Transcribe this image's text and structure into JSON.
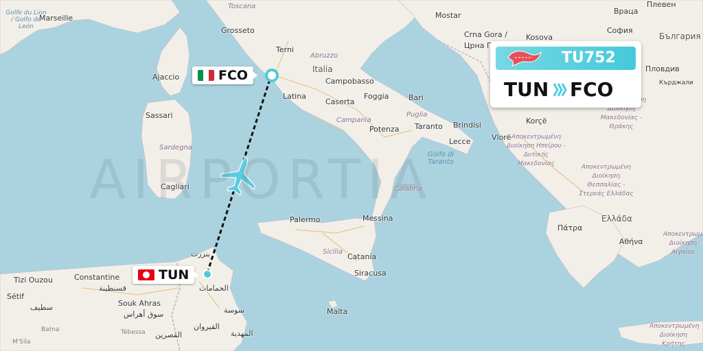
{
  "watermark": "AIRPORTIA",
  "flight": {
    "number": "TU752",
    "origin": "TUN",
    "destination": "FCO",
    "origin_flag": "tunisia-flag",
    "destination_flag": "italy-flag",
    "airline_logo": "tunisair-logo",
    "route_icon": "triple-chevron-right-icon",
    "aircraft_icon": "airplane-icon"
  },
  "colors": {
    "sea": "#aad3df",
    "land": "#f2efe9",
    "accent": "#4ecbdb",
    "route_line": "#111111"
  },
  "labels": {
    "marseille": "Marseille",
    "golfe": "Golfe du Lion / Golfo de León",
    "toscana": "Toscana",
    "grosseto": "Grosseto",
    "terni": "Terni",
    "abruzzo": "Abruzzo",
    "italia": "Italia",
    "campobasso": "Campobasso",
    "latina": "Latina",
    "caserta": "Caserta",
    "foggia": "Foggia",
    "bari": "Bari",
    "puglia": "Puglia",
    "campania": "Campania",
    "potenza": "Potenza",
    "taranto": "Taranto",
    "brindisi": "Brindisi",
    "lecce": "Lecce",
    "golfo_taranto": "Golfo di Taranto",
    "calabria": "Calabria",
    "ajaccio": "Ajaccio",
    "sassari": "Sassari",
    "sardegna": "Sardegna",
    "cagliari": "Cagliari",
    "palermo": "Palermo",
    "messina": "Messina",
    "sicilia": "Sicilia",
    "catania": "Catania",
    "siracusa": "Siracusa",
    "malta": "Malta",
    "mostar": "Mostar",
    "crna_gora": "Crna Gora /",
    "crna_gora2": "Црна Гора",
    "kosova": "Kosova",
    "sofia": "София",
    "vratsa": "Враца",
    "pleven": "Плевен",
    "bulgaria": "България",
    "plovdiv": "Пловдив",
    "kardzhali": "Кърджали",
    "korce": "Korçë",
    "vlore": "Vlorë",
    "epirus": "Αποκεντρωμένη Διοίκηση Ηπείρου - Δυτικής Μακεδονίας",
    "macedonia": "Αποκεντρωμένη Διοίκηση Μακεδονίας - Θράκης",
    "thessaly": "Αποκεντρωμένη Διοίκηση Θεσσαλίας - Στερεάς Ελλάδας",
    "patra": "Πάτρα",
    "ellada": "Ελλάδα",
    "athina": "Αθήνα",
    "aegean": "Αποκεντρωμένη Διοίκηση Αιγαίου",
    "crete": "Αποκεντρωμένη Διοίκηση Κρήτης",
    "constantine": "Constantine",
    "constantine_ar": "قسنطينة",
    "setif": "Sétif",
    "setif_ar": "سطيف",
    "tizi": "Tizi Ouzou",
    "souk": "Souk Ahras",
    "souk_ar": "سوق أهراس",
    "tebessa": "Tébessa",
    "batna": "Batna",
    "msila": "M'Sila",
    "kasserine": "القصرين",
    "kairouan": "القيروان",
    "sousse": "سوسة",
    "mahdia": "المهدية",
    "bizerte": "بنزرت",
    "hammamet": "الحمامات"
  }
}
